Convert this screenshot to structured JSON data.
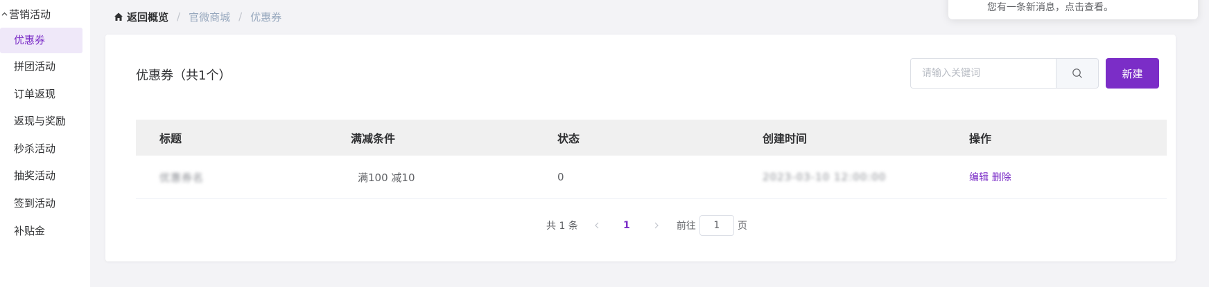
{
  "sidebar": {
    "group_title": "营销活动",
    "items": [
      {
        "label": "优惠券",
        "active": true
      },
      {
        "label": "拼团活动"
      },
      {
        "label": "订单返现"
      },
      {
        "label": "返现与奖励"
      },
      {
        "label": "秒杀活动"
      },
      {
        "label": "抽奖活动"
      },
      {
        "label": "签到活动"
      },
      {
        "label": "补贴金"
      }
    ]
  },
  "breadcrumb": {
    "home_label": "返回概览",
    "items": [
      "官微商城",
      "优惠券"
    ]
  },
  "notification": {
    "text": "您有一条新消息，点击查看。"
  },
  "card": {
    "title": "优惠券（共1个）",
    "search_placeholder": "请输入关键词",
    "new_button": "新建"
  },
  "table": {
    "columns": [
      "标题",
      "满减条件",
      "状态",
      "创建时间",
      "操作"
    ],
    "rows": [
      {
        "title": "优惠券名",
        "condition": "满100 减10",
        "status": "0",
        "created": "2023-03-10 12:00:00",
        "edit_label": "编辑",
        "delete_label": "删除"
      }
    ]
  },
  "pagination": {
    "total_text": "共 1 条",
    "current_page": "1",
    "goto_prefix": "前往",
    "goto_value": "1",
    "goto_suffix": "页"
  },
  "colors": {
    "accent": "#7b2dc7",
    "active_bg": "#efe8f9",
    "page_bg": "#f3f3f6"
  }
}
